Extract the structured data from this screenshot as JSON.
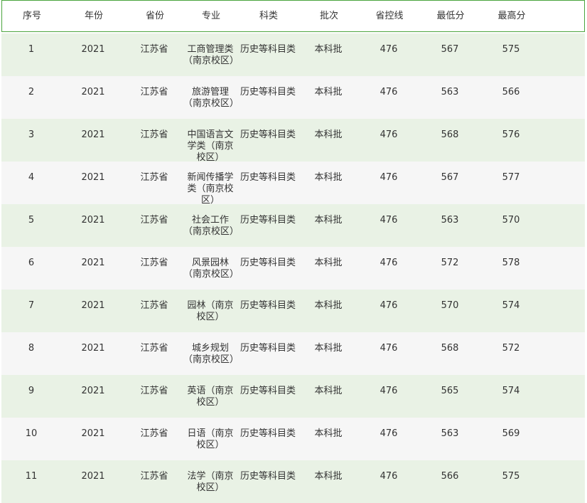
{
  "columns": [
    "序号",
    "年份",
    "省份",
    "专业",
    "科类",
    "批次",
    "省控线",
    "最低分",
    "最高分"
  ],
  "rows": [
    [
      "1",
      "2021",
      "江苏省",
      "工商管理类（南京校区）",
      "历史等科目类",
      "本科批",
      "476",
      "567",
      "575"
    ],
    [
      "2",
      "2021",
      "江苏省",
      "旅游管理（南京校区）",
      "历史等科目类",
      "本科批",
      "476",
      "563",
      "566"
    ],
    [
      "3",
      "2021",
      "江苏省",
      "中国语言文学类（南京校区）",
      "历史等科目类",
      "本科批",
      "476",
      "568",
      "576"
    ],
    [
      "4",
      "2021",
      "江苏省",
      "新闻传播学类（南京校区）",
      "历史等科目类",
      "本科批",
      "476",
      "567",
      "577"
    ],
    [
      "5",
      "2021",
      "江苏省",
      "社会工作（南京校区）",
      "历史等科目类",
      "本科批",
      "476",
      "563",
      "570"
    ],
    [
      "6",
      "2021",
      "江苏省",
      "风景园林（南京校区）",
      "历史等科目类",
      "本科批",
      "476",
      "572",
      "578"
    ],
    [
      "7",
      "2021",
      "江苏省",
      "园林（南京校区）",
      "历史等科目类",
      "本科批",
      "476",
      "570",
      "574"
    ],
    [
      "8",
      "2021",
      "江苏省",
      "城乡规划（南京校区）",
      "历史等科目类",
      "本科批",
      "476",
      "568",
      "572"
    ],
    [
      "9",
      "2021",
      "江苏省",
      "英语（南京校区）",
      "历史等科目类",
      "本科批",
      "476",
      "565",
      "574"
    ],
    [
      "10",
      "2021",
      "江苏省",
      "日语（南京校区）",
      "历史等科目类",
      "本科批",
      "476",
      "563",
      "569"
    ],
    [
      "11",
      "2021",
      "江苏省",
      "法学（南京校区）",
      "历史等科目类",
      "本科批",
      "476",
      "566",
      "575"
    ]
  ]
}
